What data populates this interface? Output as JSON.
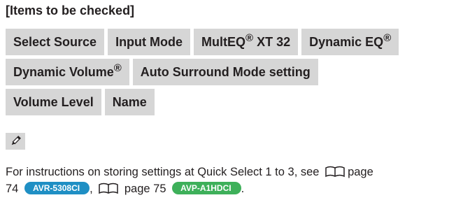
{
  "heading": "[Items to be checked]",
  "tags_row1": [
    {
      "label": "Select Source",
      "sup": ""
    },
    {
      "label": "Input Mode",
      "sup": ""
    },
    {
      "label": "MultEQ",
      "sup": "®",
      "suffix": " XT 32"
    },
    {
      "label": "Dynamic EQ",
      "sup": "®"
    }
  ],
  "tags_row2": [
    {
      "label": "Dynamic Volume",
      "sup": "®"
    },
    {
      "label": "Auto Surround Mode setting",
      "sup": ""
    }
  ],
  "tags_row3": [
    {
      "label": "Volume Level",
      "sup": ""
    },
    {
      "label": "Name",
      "sup": ""
    }
  ],
  "note": {
    "line1": "For instructions on storing settings at Quick Select 1 to 3, see",
    "line1_page": "page",
    "line2_page_num": "74",
    "badge1": "AVR-5308CI",
    "line2_mid": ",",
    "line2_page2": "page 75",
    "badge2": "AVP-A1HDCI",
    "line2_end": "."
  },
  "colors": {
    "tag_bg": "#d6d6d6",
    "badge_blue": "#1f8fc4",
    "badge_green": "#3eb05a"
  },
  "icons": [
    "pencil-icon",
    "book-icon"
  ]
}
